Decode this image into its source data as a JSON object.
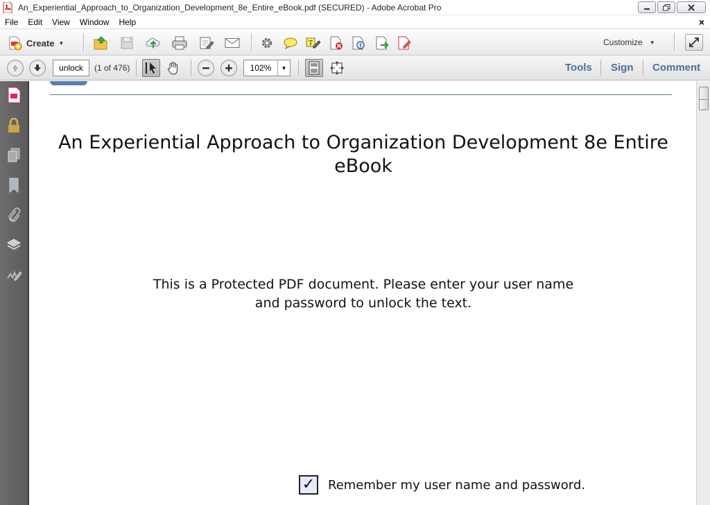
{
  "window": {
    "title": "An_Experiential_Approach_to_Organization_Development_8e_Entire_eBook.pdf (SECURED) - Adobe Acrobat Pro",
    "controls": [
      "minimize-icon",
      "restore-icon",
      "close-icon"
    ]
  },
  "menubar": {
    "items": [
      "File",
      "Edit",
      "View",
      "Window",
      "Help"
    ],
    "close_doc": "×"
  },
  "toolbar": {
    "create_label": "Create",
    "icons": [
      "open-icon",
      "save-icon",
      "cloud-upload-icon",
      "print-icon",
      "edit-icon",
      "email-icon",
      "settings-icon",
      "comment-icon",
      "highlight-icon",
      "delete-icon",
      "attach-icon",
      "export-icon",
      "sign-icon"
    ],
    "customize_label": "Customize"
  },
  "nav": {
    "page_value": "unlock",
    "page_count": "(1 of 476)",
    "zoom": "102%",
    "tools_label": "Tools",
    "sign_label": "Sign",
    "comment_label": "Comment"
  },
  "sidebar": {
    "icons": [
      "pdf-portfolio-icon",
      "lock-icon",
      "pages-icon",
      "bookmark-icon",
      "paperclip-icon",
      "layers-icon",
      "signature-icon"
    ]
  },
  "document": {
    "title": "An Experiential Approach to Organization Development 8e Entire eBook",
    "message_line1": "This is a Protected PDF document. Please enter your user name",
    "message_line2": "and password to unlock the text.",
    "remember_label": "Remember my user name and password.",
    "remember_checked": true
  },
  "colors": {
    "panel_link": "#4d6f96",
    "sidebar_bg": "#5f5f5f",
    "checkbox_bg": "#e5eafb"
  }
}
